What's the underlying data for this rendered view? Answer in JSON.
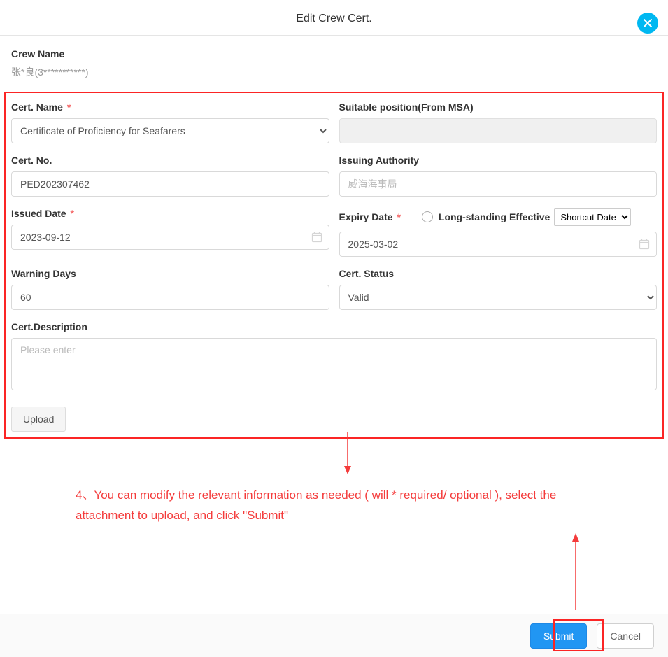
{
  "header": {
    "title": "Edit Crew Cert.",
    "close_icon": "close-icon"
  },
  "crew": {
    "name_label": "Crew Name",
    "name_value": "张*良(3***********)"
  },
  "form": {
    "certName": {
      "label": "Cert. Name",
      "value": "Certificate of Proficiency for Seafarers"
    },
    "suitablePosition": {
      "label": "Suitable position(From MSA)",
      "value": ""
    },
    "certNo": {
      "label": "Cert. No.",
      "value": "PED202307462"
    },
    "issuingAuthority": {
      "label": "Issuing Authority",
      "placeholder": "威海海事局",
      "value": ""
    },
    "issuedDate": {
      "label": "Issued Date",
      "value": "2023-09-12"
    },
    "expiryDate": {
      "label": "Expiry Date",
      "longstanding_label": "Long-standing Effective",
      "shortcut_label": "Shortcut Date",
      "value": "2025-03-02"
    },
    "warningDays": {
      "label": "Warning Days",
      "value": "60"
    },
    "certStatus": {
      "label": "Cert. Status",
      "value": "Valid"
    },
    "certDescription": {
      "label": "Cert.Description",
      "placeholder": "Please enter",
      "value": ""
    },
    "upload": {
      "label": "Upload"
    }
  },
  "annotation": {
    "text": "4、You can modify the relevant information as needed ( will * required/ optional ), select the attachment to upload, and click \"Submit\""
  },
  "footer": {
    "submit": "Submit",
    "cancel": "Cancel"
  }
}
